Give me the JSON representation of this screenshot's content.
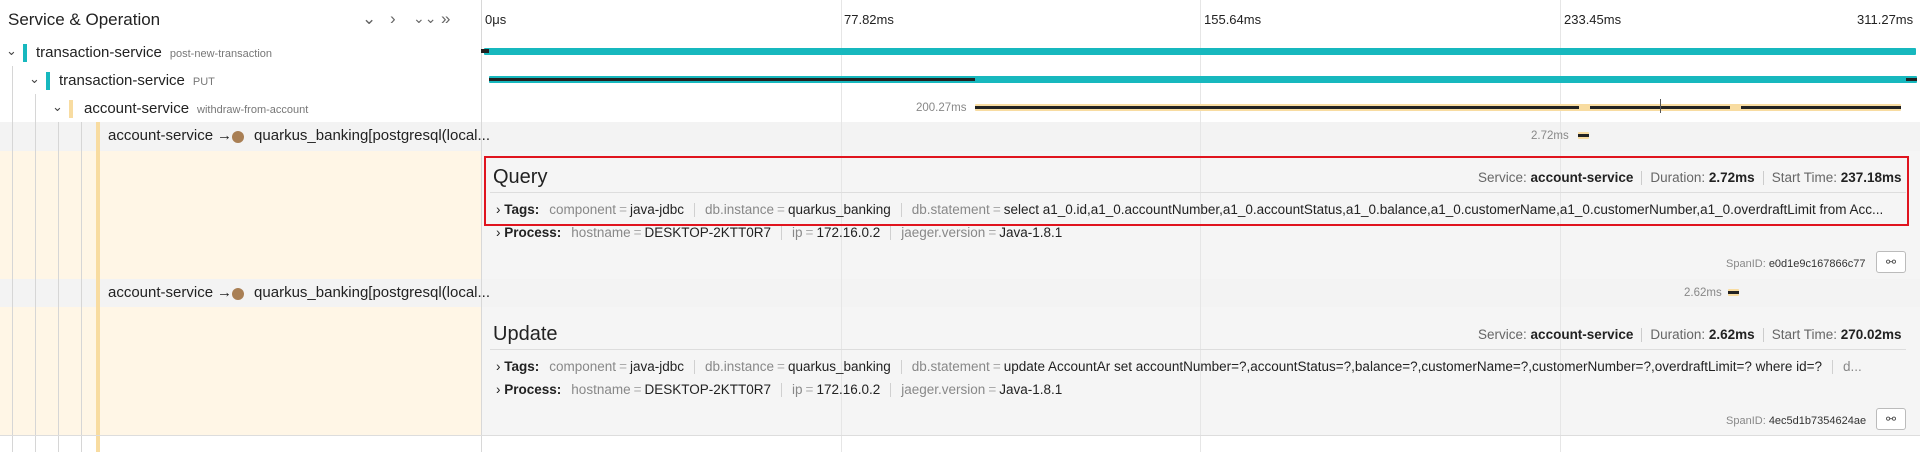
{
  "header": {
    "title": "Service & Operation",
    "controls": [
      "⌄",
      "›",
      "⌄⌄",
      "»"
    ],
    "ticks": [
      "0μs",
      "77.82ms",
      "155.64ms",
      "233.45ms",
      "311.27ms"
    ]
  },
  "colors": {
    "teal": "#17b8be",
    "tan": "#f8dca1",
    "highlight": "#e0141e",
    "row_band": "#fff6e6"
  },
  "rows": [
    {
      "service": "transaction-service",
      "operation": "post-new-transaction"
    },
    {
      "service": "transaction-service",
      "operation": "PUT"
    },
    {
      "service": "account-service",
      "operation": "withdraw-from-account",
      "duration_label": "200.27ms"
    },
    {
      "caller": "account-service",
      "arrow": "→",
      "db": "quarkus_banking[postgresql(local...",
      "duration_label": "2.72ms"
    },
    {
      "caller": "account-service",
      "arrow": "→",
      "db": "quarkus_banking[postgresql(local...",
      "duration_label": "2.62ms"
    }
  ],
  "details": [
    {
      "title": "Query",
      "service_label": "Service:",
      "service": "account-service",
      "duration_label": "Duration:",
      "duration": "2.72ms",
      "start_label": "Start Time:",
      "start": "237.18ms",
      "tags_label": "Tags:",
      "tags": [
        {
          "k": "component",
          "v": "java-jdbc"
        },
        {
          "k": "db.instance",
          "v": "quarkus_banking"
        },
        {
          "k": "db.statement",
          "v": "select a1_0.id,a1_0.accountNumber,a1_0.accountStatus,a1_0.balance,a1_0.customerName,a1_0.customerNumber,a1_0.overdraftLimit from Acc..."
        }
      ],
      "process_label": "Process:",
      "process": [
        {
          "k": "hostname",
          "v": "DESKTOP-2KTT0R7"
        },
        {
          "k": "ip",
          "v": "172.16.0.2"
        },
        {
          "k": "jaeger.version",
          "v": "Java-1.8.1"
        }
      ],
      "spanid_label": "SpanID:",
      "spanid": "e0d1e9c167866c77"
    },
    {
      "title": "Update",
      "service_label": "Service:",
      "service": "account-service",
      "duration_label": "Duration:",
      "duration": "2.62ms",
      "start_label": "Start Time:",
      "start": "270.02ms",
      "tags_label": "Tags:",
      "tags": [
        {
          "k": "component",
          "v": "java-jdbc"
        },
        {
          "k": "db.instance",
          "v": "quarkus_banking"
        },
        {
          "k": "db.statement",
          "v": "update AccountAr set accountNumber=?,accountStatus=?,balance=?,customerName=?,customerNumber=?,overdraftLimit=? where id=?"
        },
        {
          "k": "d...",
          "v": ""
        }
      ],
      "process_label": "Process:",
      "process": [
        {
          "k": "hostname",
          "v": "DESKTOP-2KTT0R7"
        },
        {
          "k": "ip",
          "v": "172.16.0.2"
        },
        {
          "k": "jaeger.version",
          "v": "Java-1.8.1"
        }
      ],
      "spanid_label": "SpanID:",
      "spanid": "4ec5d1b7354624ae"
    }
  ]
}
